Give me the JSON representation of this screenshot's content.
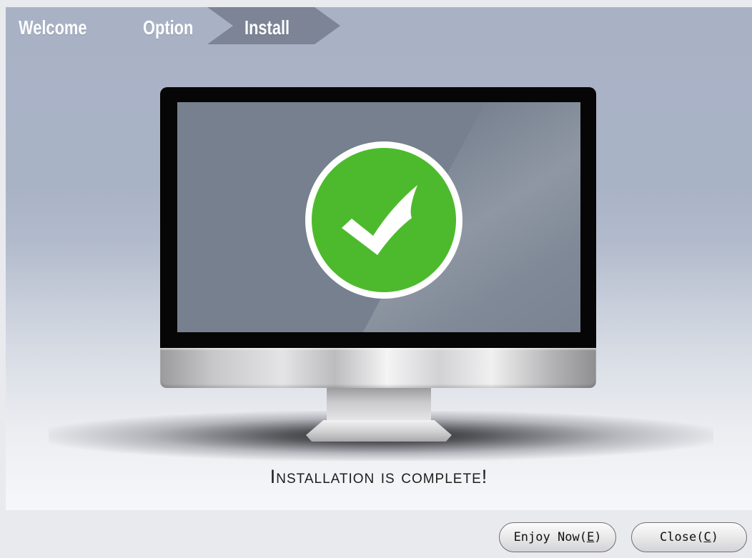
{
  "steps": [
    {
      "label": "Welcome",
      "state": "done"
    },
    {
      "label": "Option",
      "state": "done"
    },
    {
      "label": "Install",
      "state": "current"
    }
  ],
  "status": {
    "message": "Installation is complete!"
  },
  "buttons": {
    "enjoy": {
      "text": "Enjoy Now",
      "mnemonic": "E"
    },
    "close": {
      "text": "Close",
      "mnemonic": "C"
    }
  },
  "colors": {
    "current_step": "#7c8496",
    "check_green": "#4dba2e",
    "screen": "#76808f",
    "bezel": "#060606"
  },
  "icons": {
    "completion": "checkmark-circle-icon",
    "monitor": "monitor-illustration"
  }
}
